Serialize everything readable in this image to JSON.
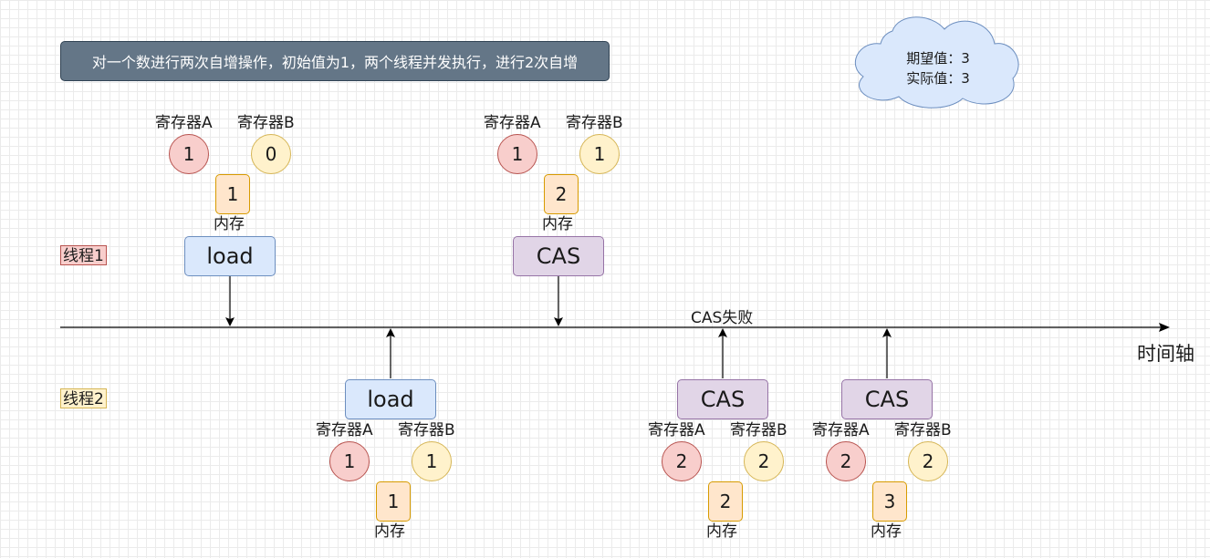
{
  "title": "对一个数进行两次自增操作，初始值为1，两个线程并发执行，进行2次自增",
  "cloud": {
    "expected": "期望值：3",
    "actual": "实际值：3"
  },
  "threads": {
    "t1": "线程1",
    "t2": "线程2"
  },
  "axis_label": "时间轴",
  "cas_fail_label": "CAS失败",
  "register_a_label": "寄存器A",
  "register_b_label": "寄存器B",
  "memory_label": "内存",
  "steps": [
    {
      "op": "load",
      "reg_a": "1",
      "reg_b": "0",
      "mem": "1"
    },
    {
      "op": "CAS",
      "reg_a": "1",
      "reg_b": "1",
      "mem": "2"
    },
    {
      "op": "load",
      "reg_a": "1",
      "reg_b": "1",
      "mem": "1"
    },
    {
      "op": "CAS",
      "reg_a": "2",
      "reg_b": "2",
      "mem": "2"
    },
    {
      "op": "CAS",
      "reg_a": "2",
      "reg_b": "2",
      "mem": "3"
    }
  ],
  "colors": {
    "title_bg": "#647687",
    "thread1_bg": "#f8cecc",
    "thread2_bg": "#fff2cc",
    "load_bg": "#dae8fc",
    "cas_bg": "#e1d5e7",
    "memory_bg": "#ffe6cc",
    "cloud_bg": "#dae8fc"
  }
}
